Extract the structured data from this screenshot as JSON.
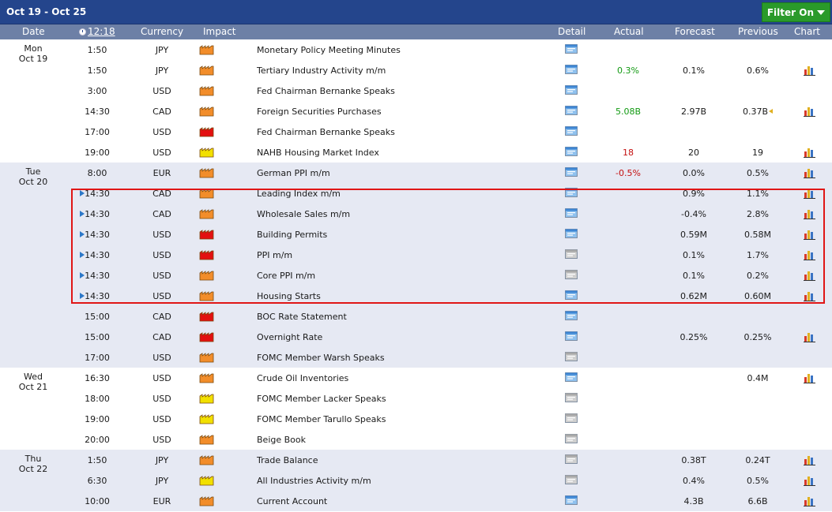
{
  "topbar": {
    "range": "Oct 19 - Oct 25",
    "filter_label": "Filter On"
  },
  "header": {
    "date": "Date",
    "time": "12:18",
    "currency": "Currency",
    "impact": "Impact",
    "detail": "Detail",
    "actual": "Actual",
    "forecast": "Forecast",
    "previous": "Previous",
    "chart": "Chart"
  },
  "colors": {
    "high": "#e31010",
    "medium": "#f28d2a",
    "low": "#f2e000",
    "accent": "#24458c",
    "header": "#6d80a6",
    "highlight": "#e01616"
  },
  "days": [
    {
      "weekday": "Mon",
      "date": "Oct 19",
      "rows": [
        {
          "time": "1:50",
          "currency": "JPY",
          "impact": "medium",
          "event": "Monetary Policy Meeting Minutes",
          "actual": "",
          "actual_color": "",
          "forecast": "",
          "previous": "",
          "detail": "blue",
          "chart": false,
          "play": false
        },
        {
          "time": "1:50",
          "currency": "JPY",
          "impact": "medium",
          "event": "Tertiary Industry Activity m/m",
          "actual": "0.3%",
          "actual_color": "green",
          "forecast": "0.1%",
          "previous": "0.6%",
          "detail": "blue",
          "chart": true,
          "play": false
        },
        {
          "time": "3:00",
          "currency": "USD",
          "impact": "medium",
          "event": "Fed Chairman Bernanke Speaks",
          "actual": "",
          "actual_color": "",
          "forecast": "",
          "previous": "",
          "detail": "blue",
          "chart": false,
          "play": false
        },
        {
          "time": "14:30",
          "currency": "CAD",
          "impact": "medium",
          "event": "Foreign Securities Purchases",
          "actual": "5.08B",
          "actual_color": "green",
          "forecast": "2.97B",
          "previous": "0.37B",
          "previous_flag": true,
          "detail": "blue",
          "chart": true,
          "play": false
        },
        {
          "time": "17:00",
          "currency": "USD",
          "impact": "high",
          "event": "Fed Chairman Bernanke Speaks",
          "actual": "",
          "actual_color": "",
          "forecast": "",
          "previous": "",
          "detail": "blue",
          "chart": false,
          "play": false
        },
        {
          "time": "19:00",
          "currency": "USD",
          "impact": "low",
          "event": "NAHB Housing Market Index",
          "actual": "18",
          "actual_color": "red",
          "forecast": "20",
          "previous": "19",
          "detail": "blue",
          "chart": true,
          "play": false
        }
      ]
    },
    {
      "weekday": "Tue",
      "date": "Oct 20",
      "rows": [
        {
          "time": "8:00",
          "currency": "EUR",
          "impact": "medium",
          "event": "German PPI m/m",
          "actual": "-0.5%",
          "actual_color": "red",
          "forecast": "0.0%",
          "previous": "0.5%",
          "detail": "blue",
          "chart": true,
          "play": false
        },
        {
          "time": "14:30",
          "currency": "CAD",
          "impact": "medium",
          "event": "Leading Index m/m",
          "actual": "",
          "actual_color": "",
          "forecast": "0.9%",
          "previous": "1.1%",
          "detail": "blue",
          "chart": true,
          "play": true
        },
        {
          "time": "14:30",
          "currency": "CAD",
          "impact": "medium",
          "event": "Wholesale Sales m/m",
          "actual": "",
          "actual_color": "",
          "forecast": "-0.4%",
          "previous": "2.8%",
          "detail": "blue",
          "chart": true,
          "play": true
        },
        {
          "time": "14:30",
          "currency": "USD",
          "impact": "high",
          "event": "Building Permits",
          "actual": "",
          "actual_color": "",
          "forecast": "0.59M",
          "previous": "0.58M",
          "detail": "blue",
          "chart": true,
          "play": true
        },
        {
          "time": "14:30",
          "currency": "USD",
          "impact": "high",
          "event": "PPI m/m",
          "actual": "",
          "actual_color": "",
          "forecast": "0.1%",
          "previous": "1.7%",
          "detail": "gray",
          "chart": true,
          "play": true
        },
        {
          "time": "14:30",
          "currency": "USD",
          "impact": "medium",
          "event": "Core PPI m/m",
          "actual": "",
          "actual_color": "",
          "forecast": "0.1%",
          "previous": "0.2%",
          "detail": "gray",
          "chart": true,
          "play": true
        },
        {
          "time": "14:30",
          "currency": "USD",
          "impact": "medium",
          "event": "Housing Starts",
          "actual": "",
          "actual_color": "",
          "forecast": "0.62M",
          "previous": "0.60M",
          "detail": "blue",
          "chart": true,
          "play": true
        },
        {
          "time": "15:00",
          "currency": "CAD",
          "impact": "high",
          "event": "BOC Rate Statement",
          "actual": "",
          "actual_color": "",
          "forecast": "",
          "previous": "",
          "detail": "blue",
          "chart": false,
          "play": false
        },
        {
          "time": "15:00",
          "currency": "CAD",
          "impact": "high",
          "event": "Overnight Rate",
          "actual": "",
          "actual_color": "",
          "forecast": "0.25%",
          "previous": "0.25%",
          "detail": "blue",
          "chart": true,
          "play": false
        },
        {
          "time": "17:00",
          "currency": "USD",
          "impact": "medium",
          "event": "FOMC Member Warsh Speaks",
          "actual": "",
          "actual_color": "",
          "forecast": "",
          "previous": "",
          "detail": "gray",
          "chart": false,
          "play": false
        }
      ]
    },
    {
      "weekday": "Wed",
      "date": "Oct 21",
      "rows": [
        {
          "time": "16:30",
          "currency": "USD",
          "impact": "medium",
          "event": "Crude Oil Inventories",
          "actual": "",
          "actual_color": "",
          "forecast": "",
          "previous": "0.4M",
          "detail": "blue",
          "chart": true,
          "play": false
        },
        {
          "time": "18:00",
          "currency": "USD",
          "impact": "low",
          "event": "FOMC Member Lacker Speaks",
          "actual": "",
          "actual_color": "",
          "forecast": "",
          "previous": "",
          "detail": "gray",
          "chart": false,
          "play": false
        },
        {
          "time": "19:00",
          "currency": "USD",
          "impact": "low",
          "event": "FOMC Member Tarullo Speaks",
          "actual": "",
          "actual_color": "",
          "forecast": "",
          "previous": "",
          "detail": "gray",
          "chart": false,
          "play": false
        },
        {
          "time": "20:00",
          "currency": "USD",
          "impact": "medium",
          "event": "Beige Book",
          "actual": "",
          "actual_color": "",
          "forecast": "",
          "previous": "",
          "detail": "gray",
          "chart": false,
          "play": false
        }
      ]
    },
    {
      "weekday": "Thu",
      "date": "Oct 22",
      "rows": [
        {
          "time": "1:50",
          "currency": "JPY",
          "impact": "medium",
          "event": "Trade Balance",
          "actual": "",
          "actual_color": "",
          "forecast": "0.38T",
          "previous": "0.24T",
          "detail": "gray",
          "chart": true,
          "play": false
        },
        {
          "time": "6:30",
          "currency": "JPY",
          "impact": "low",
          "event": "All Industries Activity m/m",
          "actual": "",
          "actual_color": "",
          "forecast": "0.4%",
          "previous": "0.5%",
          "detail": "gray",
          "chart": true,
          "play": false
        },
        {
          "time": "10:00",
          "currency": "EUR",
          "impact": "medium",
          "event": "Current Account",
          "actual": "",
          "actual_color": "",
          "forecast": "4.3B",
          "previous": "6.6B",
          "detail": "blue",
          "chart": true,
          "play": false
        }
      ]
    }
  ]
}
